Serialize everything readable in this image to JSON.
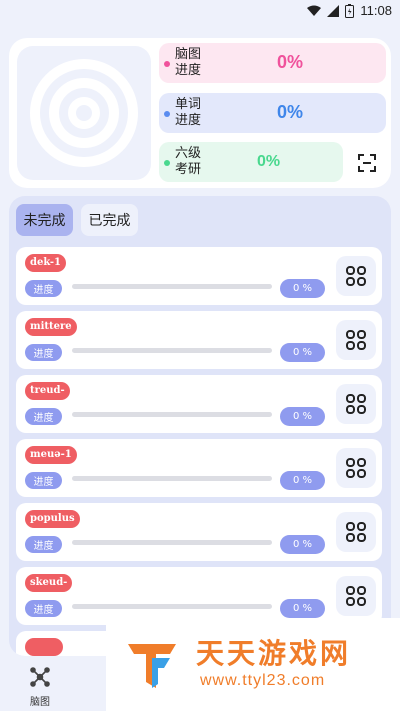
{
  "status_bar": {
    "time": "11:08"
  },
  "stats": [
    {
      "label_line1": "脑图",
      "label_line2": "进度",
      "percent": "0%",
      "dot_color": "#f0529c",
      "bg": "#fde7f1",
      "text_color": "#f0529c"
    },
    {
      "label_line1": "单词",
      "label_line2": "进度",
      "percent": "0%",
      "dot_color": "#5a8cf0",
      "bg": "#e3e8fb",
      "text_color": "#3f86ea"
    },
    {
      "label_line1": "六级",
      "label_line2": "考研",
      "percent": "0%",
      "dot_color": "#49d88e",
      "bg": "#e6f8ee",
      "text_color": "#49d88e"
    }
  ],
  "tabs": [
    {
      "label": "未完成",
      "active": true
    },
    {
      "label": "已完成",
      "active": false
    }
  ],
  "rows": [
    {
      "word": "dek-1",
      "progress_label": "进度",
      "percent_text": "0 %",
      "progress": 0
    },
    {
      "word": "mittere",
      "progress_label": "进度",
      "percent_text": "0 %",
      "progress": 0
    },
    {
      "word": "treud-",
      "progress_label": "进度",
      "percent_text": "0 %",
      "progress": 0
    },
    {
      "word": "meuə-1",
      "progress_label": "进度",
      "percent_text": "0 %",
      "progress": 0
    },
    {
      "word": "populus",
      "progress_label": "进度",
      "percent_text": "0 %",
      "progress": 0
    },
    {
      "word": "skeud-",
      "progress_label": "进度",
      "percent_text": "0 %",
      "progress": 0
    }
  ],
  "bottom_nav": {
    "label": "脑图",
    "icon": "mindmap-icon"
  },
  "watermark": {
    "title": "天天游戏网",
    "url": "www.ttyl23.com"
  }
}
